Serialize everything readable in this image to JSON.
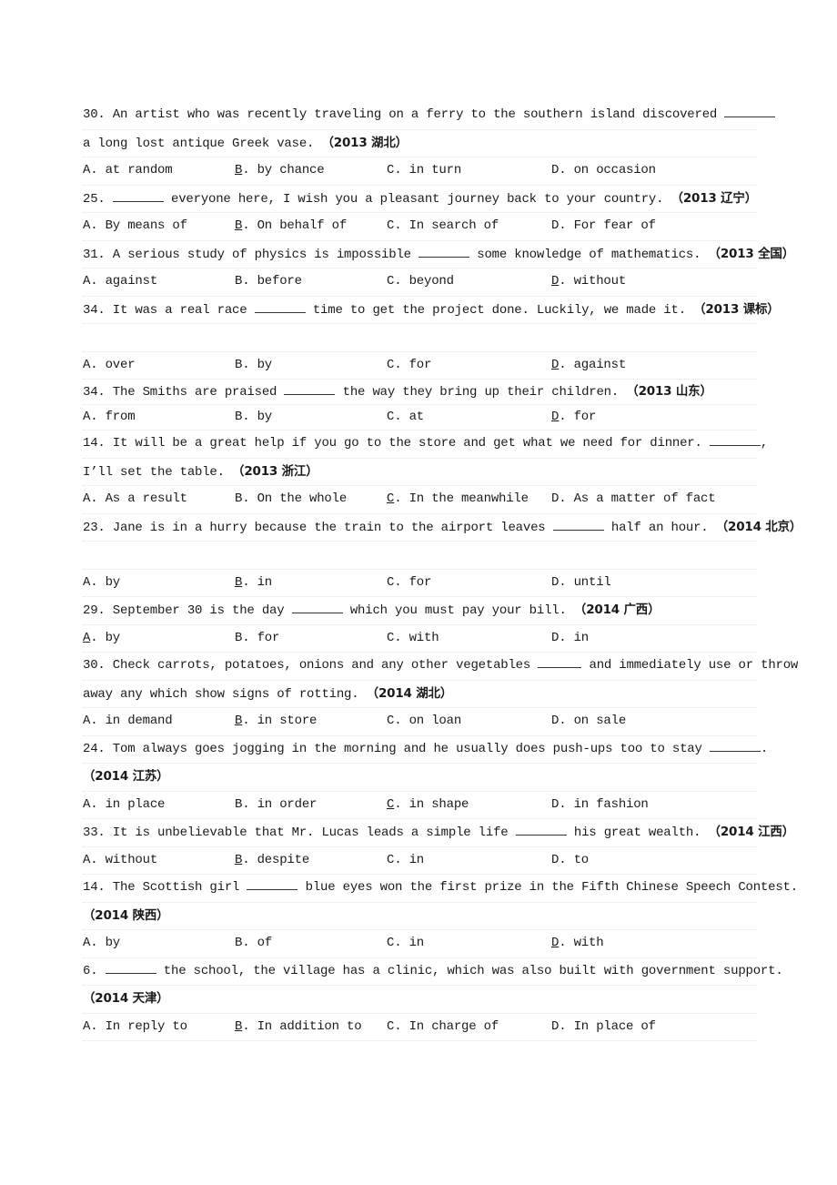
{
  "questions": [
    {
      "lines": [
        "30. An artist who was recently traveling on a ferry to the southern island discovered ",
        "a long lost antique Greek vase. "
      ],
      "blank_on_line": 0,
      "blank_pos": "end",
      "source": "（2013 湖北）",
      "options": [
        "at random",
        "by chance",
        "in turn",
        "on occasion"
      ],
      "answer": "B"
    },
    {
      "lines": [
        "25. ",
        " everyone here, I wish you a pleasant journey back to your country. "
      ],
      "source": "（2013 辽宁）",
      "options": [
        "By means of",
        "On behalf of",
        "In search of",
        "For fear of"
      ],
      "answer": "B"
    },
    {
      "lines": [
        "31. A serious study of physics is impossible ",
        " some knowledge of mathematics. "
      ],
      "source": "（2013 全国）",
      "options": [
        "against",
        "before",
        "beyond",
        "without"
      ],
      "answer": "D"
    },
    {
      "lines": [
        "34. It was a real race ",
        " time to get the project done. Luckily, we made it. "
      ],
      "source": "（2013 课标）",
      "options": [
        "over",
        "by",
        "for",
        "against"
      ],
      "answer": "D"
    },
    {
      "lines": [
        "34. The Smiths are praised ",
        " the way they bring up their children. "
      ],
      "source": "（2013 山东）",
      "options": [
        "from",
        "by",
        "at",
        "for"
      ],
      "answer": "D"
    },
    {
      "lines": [
        "14. It will be a great help if you go to the store and get what we need for dinner. ",
        ",",
        "I’ll set the table. "
      ],
      "source": "（2013 浙江）",
      "options": [
        "As a result",
        "On the whole",
        "In the meanwhile",
        "As a matter of fact"
      ],
      "answer": "C"
    },
    {
      "lines": [
        "23. Jane is in a hurry because the train to the airport leaves ",
        " half an hour. "
      ],
      "source": "（2014 北京）",
      "options": [
        "by",
        "in",
        "for",
        "until"
      ],
      "answer": "B"
    },
    {
      "lines": [
        "29. September 30 is the day ",
        " which you must pay your bill. "
      ],
      "source": "（2014 广西）",
      "options": [
        "by",
        "for",
        "with",
        "in"
      ],
      "answer": "A"
    },
    {
      "lines": [
        "30. Check carrots, potatoes, onions and any other vegetables ",
        " and immediately use or throw",
        "away any which show signs of rotting. "
      ],
      "source": "（2014 湖北）",
      "options": [
        "in demand",
        "in store",
        "on loan",
        "on sale"
      ],
      "answer": "B"
    },
    {
      "lines": [
        "24. Tom always goes jogging in the morning and he usually does push-ups too to stay ",
        "."
      ],
      "source": "（2014 江苏）",
      "options": [
        "in place",
        "in order",
        "in shape",
        "in fashion"
      ],
      "answer": "C"
    },
    {
      "lines": [
        "33. It is unbelievable that Mr. Lucas leads a simple life ",
        " his great wealth. "
      ],
      "source": "（2014 江西）",
      "options": [
        "without",
        "despite",
        "in",
        "to"
      ],
      "answer": "B"
    },
    {
      "lines": [
        "14. The Scottish girl ",
        " blue eyes won the first prize in the Fifth Chinese Speech Contest."
      ],
      "source": "（2014 陕西）",
      "options": [
        "by",
        "of",
        "in",
        "with"
      ],
      "answer": "D"
    },
    {
      "lines": [
        "6. ",
        " the school, the village has a clinic, which was also built with government support."
      ],
      "source": "（2014 天津）",
      "options": [
        "In reply to",
        "In addition to",
        "In charge of",
        "In place of"
      ],
      "answer": "B"
    }
  ],
  "option_letters": [
    "A",
    "B",
    "C",
    "D"
  ]
}
